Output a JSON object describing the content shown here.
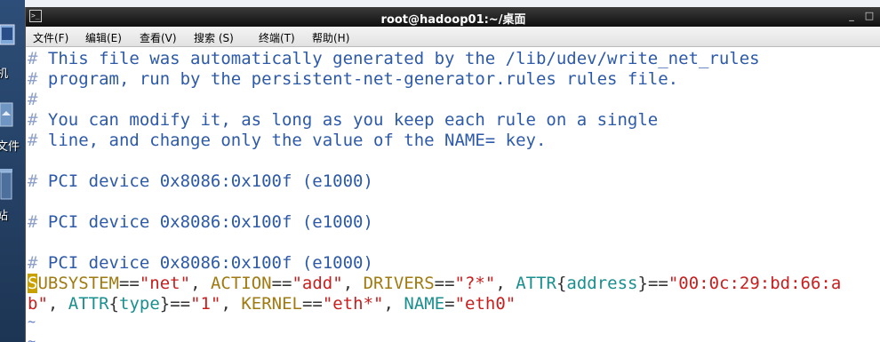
{
  "desktop": {
    "icons": [
      {
        "label": "机",
        "icon": "computer-icon"
      },
      {
        "label": "文件",
        "icon": "home-folder-icon"
      },
      {
        "label": "站",
        "icon": "trash-icon"
      }
    ]
  },
  "window": {
    "title": "root@hadoop01:~/桌面",
    "controls": [
      "_",
      "□"
    ]
  },
  "menu": {
    "items": [
      "文件(F)",
      "编辑(E)",
      "查看(V)",
      "搜索 (S)",
      "终端(T)",
      "帮助(H)"
    ]
  },
  "terminal": {
    "lines": [
      {
        "hash": "#",
        "text": " This file was automatically generated by the /lib/udev/write_net_rules"
      },
      {
        "hash": "#",
        "text": " program, run by the persistent-net-generator.rules rules file."
      },
      {
        "hash": "#",
        "text": ""
      },
      {
        "hash": "#",
        "text": " You can modify it, as long as you keep each rule on a single"
      },
      {
        "hash": "#",
        "text": " line, and change only the value of the NAME= key."
      },
      {
        "hash": "",
        "text": ""
      },
      {
        "hash": "#",
        "text": " PCI device 0x8086:0x100f (e1000)"
      },
      {
        "hash": "",
        "text": ""
      },
      {
        "hash": "#",
        "text": " PCI device 0x8086:0x100f (e1000)"
      },
      {
        "hash": "",
        "text": ""
      },
      {
        "hash": "#",
        "text": " PCI device 0x8086:0x100f (e1000)"
      }
    ],
    "rule_line1": {
      "cursor_char": "S",
      "p1": "UBSYSTEM",
      "p2": "==",
      "p3": "\"net\"",
      "p4": ", ",
      "p5": "ACTION",
      "p6": "==",
      "p7": "\"add\"",
      "p8": ", ",
      "p9": "DRIVERS",
      "p10": "==",
      "p11": "\"?*\"",
      "p12": ", ",
      "p13": "ATTR",
      "p14": "{",
      "p15": "address",
      "p16": "}",
      "p17": "==",
      "p18": "\"00:0c:29:bd:66:a"
    },
    "rule_line2": {
      "p1": "b\"",
      "p2": ", ",
      "p3": "ATTR",
      "p4": "{",
      "p5": "type",
      "p6": "}",
      "p7": "==",
      "p8": "\"1\"",
      "p9": ", ",
      "p10": "KERNEL",
      "p11": "==",
      "p12": "\"eth*\"",
      "p13": ", ",
      "p14": "NAME",
      "p15": "=",
      "p16": "\"eth0\""
    },
    "tildes": [
      "~",
      "~"
    ]
  }
}
